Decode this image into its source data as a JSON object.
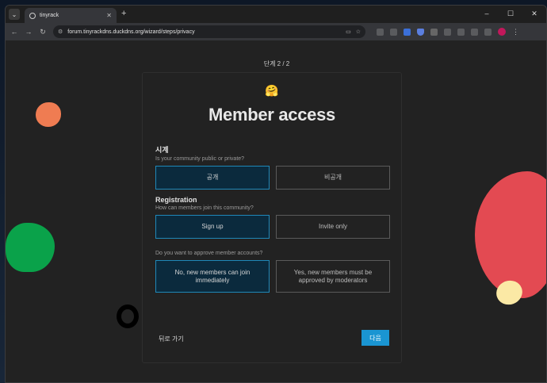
{
  "browser": {
    "tab_title": "tinyrack",
    "new_tab": "+",
    "url": "forum.tinyrackdns.duckdns.org/wizard/steps/privacy",
    "window_controls": [
      "–",
      "☐",
      "✕"
    ]
  },
  "wizard": {
    "step_indicator": "단계 2 / 2",
    "emoji": "🤗",
    "title": "Member access",
    "sections": [
      {
        "label": "시계",
        "help": "Is your community public or private?",
        "options": [
          {
            "label": "공개",
            "selected": true
          },
          {
            "label": "비공개",
            "selected": false
          }
        ]
      },
      {
        "label": "Registration",
        "help": "How can members join this community?",
        "options": [
          {
            "label": "Sign up",
            "selected": true
          },
          {
            "label": "Invite only",
            "selected": false
          }
        ]
      },
      {
        "label": "",
        "help": "Do you want to approve member accounts?",
        "options": [
          {
            "label": "No, new members can join immediately",
            "selected": true
          },
          {
            "label": "Yes, new members must be approved by moderators",
            "selected": false
          }
        ]
      }
    ],
    "back_label": "뒤로 가기",
    "next_label": "다음"
  },
  "colors": {
    "accent": "#1a95d2",
    "selected_bg": "#0b2a3d",
    "page_bg": "#222222"
  }
}
